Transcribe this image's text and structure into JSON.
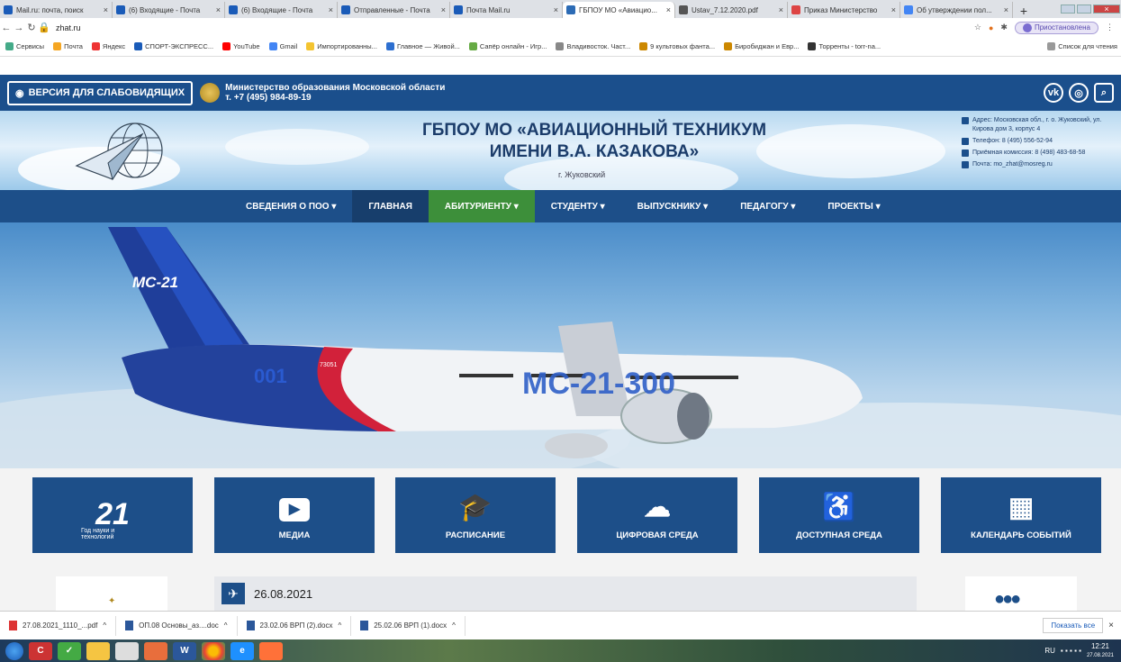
{
  "browser": {
    "tabs": [
      {
        "title": "Mail.ru: почта, поиск",
        "color": "#1a5bb8"
      },
      {
        "title": "(6) Входящие - Почта",
        "color": "#1a5bb8"
      },
      {
        "title": "(6) Входящие - Почта",
        "color": "#1a5bb8"
      },
      {
        "title": "Отправленные - Почта",
        "color": "#1a5bb8"
      },
      {
        "title": "Почта Mail.ru",
        "color": "#1a5bb8"
      },
      {
        "title": "ГБПОУ МО «Авиацио...",
        "color": "#2c6bb5"
      },
      {
        "title": "Ustav_7.12.2020.pdf",
        "color": "#555555"
      },
      {
        "title": "Приказ Министерство",
        "color": "#d44"
      },
      {
        "title": "Об утверждении пол...",
        "color": "#4285f4"
      }
    ],
    "new_tab": "+",
    "url": "zhat.ru",
    "profile_label": "Приостановлена",
    "bookmarks": [
      "Сервисы",
      "Почта",
      "Яндекс",
      "СПОРТ-ЭКСПРЕСС...",
      "YouTube",
      "Gmail",
      "Импортированны...",
      "Главное — Живой...",
      "Сапёр онлайн - Игр...",
      "Владивосток. Част...",
      "9 культовых фанта...",
      "Биробиджан и Евр...",
      "Торренты - torr-na..."
    ],
    "reading_list": "Список для чтения"
  },
  "site": {
    "low_vision_button": "ВЕРСИЯ ДЛЯ СЛАБОВИДЯЩИХ",
    "ministry_name": "Министерство образования Московской области",
    "ministry_phone": "т. +7 (495) 984-89-19",
    "title_line1": "ГБПОУ МО «АВИАЦИОННЫЙ ТЕХНИКУМ",
    "title_line2": "ИМЕНИ В.А. КАЗАКОВА»",
    "city": "г. Жуковский",
    "address": "Адрес: Московская обл., г. о. Жуковский, ул. Кирова дом 3, корпус 4",
    "phone": "Телефон: 8 (495) 556-52-94",
    "admission": "Приёмная комиссия: 8 (498) 483-68-58",
    "email": "Почта: mo_zhat@mosreg.ru",
    "menu": [
      "СВЕДЕНИЯ О ПОО ▾",
      "ГЛАВНАЯ",
      "АБИТУРИЕНТУ ▾",
      "СТУДЕНТУ ▾",
      "ВЫПУСКНИКУ ▾",
      "ПЕДАГОГУ ▾",
      "ПРОЕКТЫ ▾"
    ],
    "hero": {
      "tail_text": "MC-21",
      "reg": "73051",
      "num": "001",
      "body_text": "MC-21-300"
    },
    "tiles": [
      {
        "label": "",
        "icon": "21",
        "sub": "Год науки и технологий"
      },
      {
        "label": "МЕДИА",
        "icon": "▶"
      },
      {
        "label": "РАСПИСАНИЕ",
        "icon": "🎓"
      },
      {
        "label": "ЦИФРОВАЯ СРЕДА",
        "icon": "☁"
      },
      {
        "label": "ДОСТУПНАЯ СРЕДА",
        "icon": "♿"
      },
      {
        "label": "КАЛЕНДАРЬ СОБЫТИЙ",
        "icon": "▦"
      }
    ],
    "news_date": "26.08.2021"
  },
  "downloads": {
    "items": [
      "27.08.2021_1110_...pdf",
      "ОП.08 Основы_аз....doc",
      "23.02.06 ВРП (2).docx",
      "25.02.06 ВРП (1).docx"
    ],
    "show_all": "Показать все"
  },
  "taskbar": {
    "lang": "RU",
    "time": "12:21",
    "date": "27.08.2021"
  }
}
